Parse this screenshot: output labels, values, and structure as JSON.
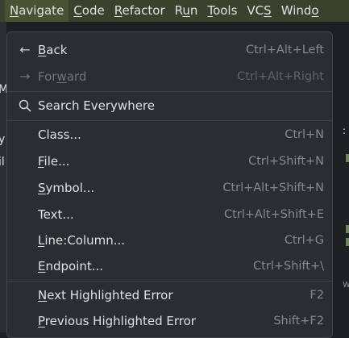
{
  "menubar": {
    "items": [
      {
        "mnemonic": "N",
        "rest": "avigate"
      },
      {
        "mnemonic": "C",
        "rest": "ode"
      },
      {
        "mnemonic": "R",
        "rest": "efactor"
      },
      {
        "pre": "R",
        "mnemonic": "u",
        "rest": "n"
      },
      {
        "mnemonic": "T",
        "rest": "ools"
      },
      {
        "pre": "VC",
        "mnemonic": "S",
        "rest": ""
      },
      {
        "pre": "Wind",
        "mnemonic": "o",
        "rest": ""
      }
    ]
  },
  "background": {
    "left_stubs": [
      "M",
      "y",
      "il"
    ],
    "right_stubs": [
      ":",
      "w"
    ]
  },
  "navigate_menu": {
    "back": {
      "icon": "arrow-left-icon",
      "mnemonic": "B",
      "rest": "ack",
      "shortcut": "Ctrl+Alt+Left"
    },
    "forward": {
      "icon": "arrow-right-icon",
      "pre": "For",
      "mnemonic": "w",
      "rest": "ard",
      "shortcut": "Ctrl+Alt+Right"
    },
    "search_everywhere": {
      "icon": "search-icon",
      "label": "Search Everywhere"
    },
    "class": {
      "label": "Class...",
      "shortcut": "Ctrl+N"
    },
    "file": {
      "mnemonic": "F",
      "rest": "ile...",
      "shortcut": "Ctrl+Shift+N"
    },
    "symbol": {
      "mnemonic": "S",
      "rest": "ymbol...",
      "shortcut": "Ctrl+Alt+Shift+N"
    },
    "text": {
      "label": "Text...",
      "shortcut": "Ctrl+Alt+Shift+E"
    },
    "line_column": {
      "mnemonic": "L",
      "rest": "ine:Column...",
      "shortcut": "Ctrl+G"
    },
    "endpoint": {
      "mnemonic": "E",
      "rest": "ndpoint...",
      "shortcut": "Ctrl+Shift+\\"
    },
    "next_error": {
      "mnemonic": "N",
      "rest": "ext Highlighted Error",
      "shortcut": "F2"
    },
    "prev_error": {
      "mnemonic": "P",
      "rest": "revious Highlighted Error",
      "shortcut": "Shift+F2"
    }
  }
}
